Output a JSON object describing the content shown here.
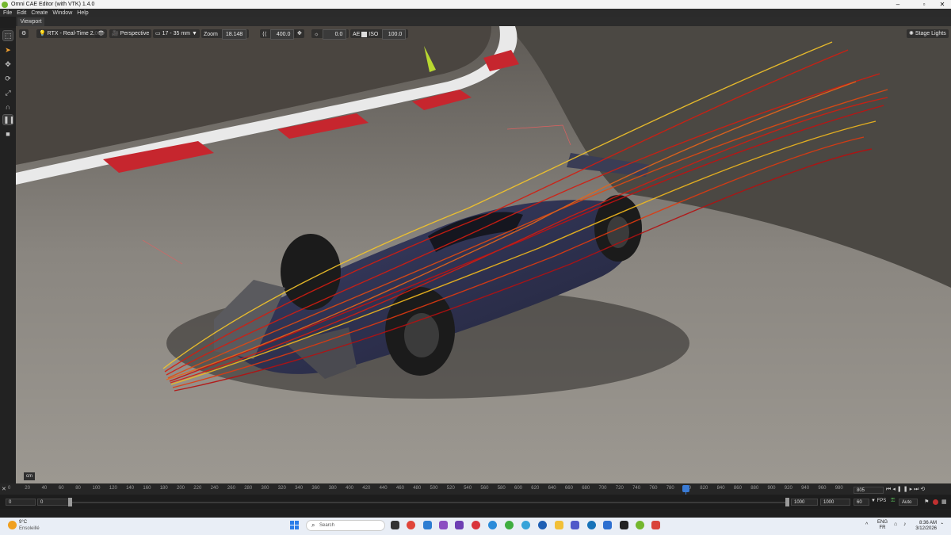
{
  "window": {
    "title": "Omni CAE Editor (with VTK) 1.4.0"
  },
  "menu": [
    "File",
    "Edit",
    "Create",
    "Window",
    "Help"
  ],
  "tabs": {
    "viewport": "Viewport"
  },
  "viewport_toolbar": {
    "renderer": "RTX - Real-Time 2.0",
    "camera": "Perspective",
    "lens": "17 - 35 mm",
    "zoom_label": "Zoom",
    "zoom_value": "18.148",
    "speed_value": "400.0",
    "exposure_value": "0.0",
    "ae_label": "AE",
    "iso_label": "ISO",
    "iso_value": "100.0",
    "lights": "Stage Lights"
  },
  "units_badge": "cm",
  "timeline": {
    "ticks": [
      "0",
      "20",
      "40",
      "60",
      "80",
      "100",
      "120",
      "140",
      "160",
      "180",
      "200",
      "220",
      "240",
      "260",
      "280",
      "300",
      "320",
      "340",
      "360",
      "380",
      "400",
      "420",
      "440",
      "460",
      "480",
      "500",
      "520",
      "540",
      "560",
      "580",
      "600",
      "620",
      "640",
      "660",
      "680",
      "700",
      "720",
      "740",
      "760",
      "780",
      "800",
      "820",
      "840",
      "860",
      "880",
      "900",
      "920",
      "940",
      "960",
      "980"
    ],
    "current_frame": "805",
    "start": "0",
    "start_inner": "0",
    "end_inner": "1000",
    "end": "1000",
    "fps_value": "60",
    "fps_label": "FPS",
    "auto_label": "Auto"
  },
  "taskbar": {
    "weather_temp": "9°C",
    "weather_desc": "Ensoleillé",
    "search_placeholder": "Search",
    "lang": "ENG",
    "region": "FR",
    "time": "8:36 AM",
    "date": "3/12/2026"
  },
  "colors": {
    "accent": "#3a7bd5",
    "streamline_red": "#d41d10",
    "streamline_yellow": "#f2b91e"
  }
}
